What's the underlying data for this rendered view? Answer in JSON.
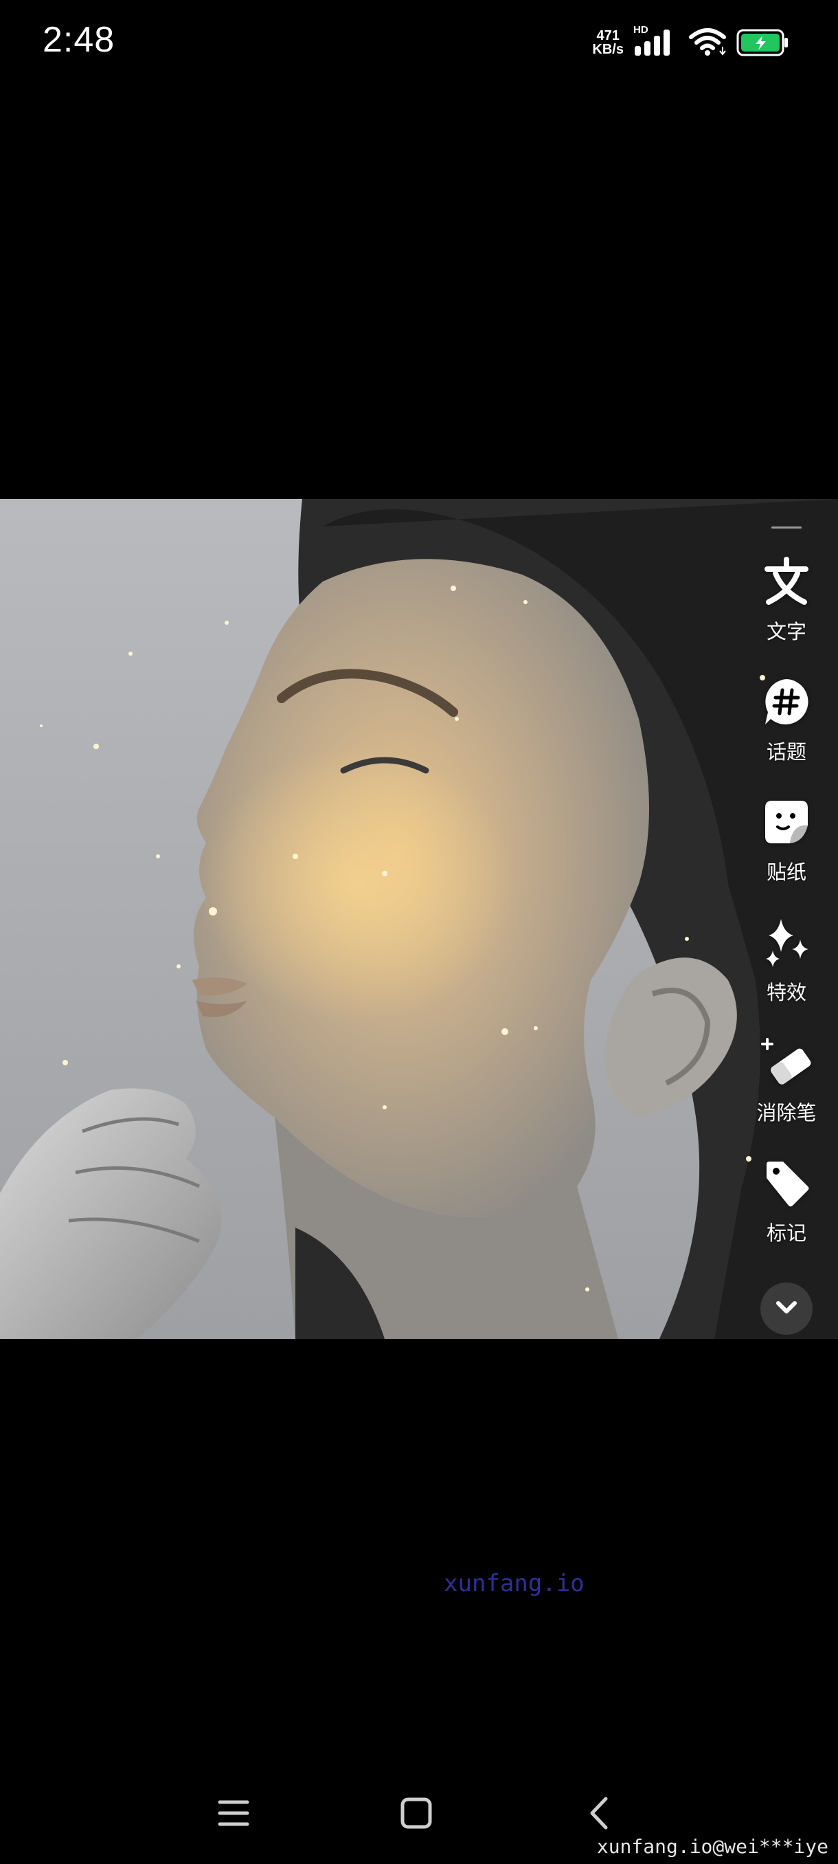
{
  "status_bar": {
    "time": "2:48",
    "net_speed_value": "471",
    "net_speed_unit": "KB/s",
    "signal_label": "HD",
    "battery_color": "#22c55e"
  },
  "photo": {
    "icon": "portrait-photo"
  },
  "toolbar": {
    "items": [
      {
        "label": "文字",
        "icon": "text-icon"
      },
      {
        "label": "话题",
        "icon": "hashtag-icon"
      },
      {
        "label": "贴纸",
        "icon": "sticker-icon"
      },
      {
        "label": "特效",
        "icon": "sparkle-effects-icon"
      },
      {
        "label": "消除笔",
        "icon": "eraser-icon"
      },
      {
        "label": "标记",
        "icon": "tag-icon"
      }
    ],
    "collapse_icon": "chevron-down-icon"
  },
  "watermarks": {
    "center": "xunfang.io",
    "corner": "xunfang.io@wei***iye"
  },
  "nav_bar": {
    "menu_icon": "menu-icon",
    "home_icon": "home-square-icon",
    "back_icon": "back-chevron-icon"
  }
}
